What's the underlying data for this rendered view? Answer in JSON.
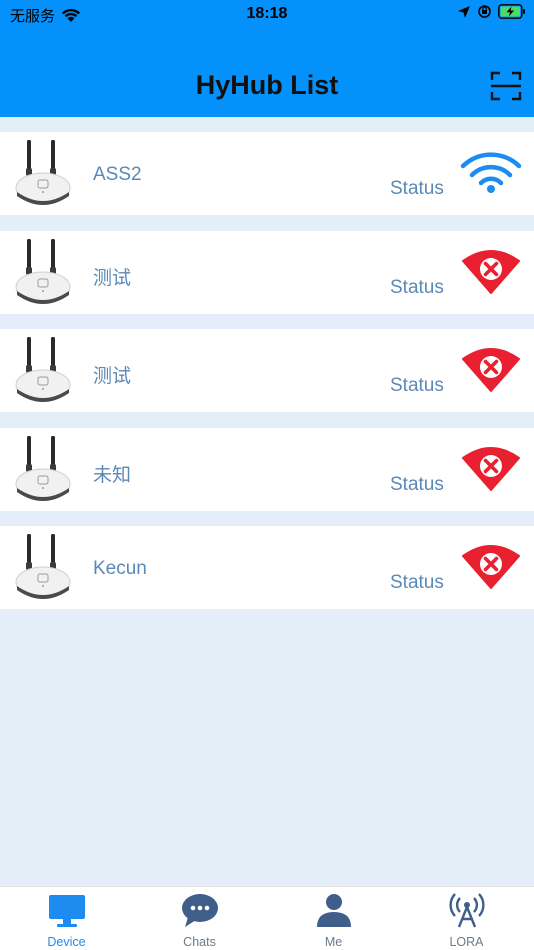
{
  "status_bar": {
    "carrier": "无服务",
    "time": "18:18"
  },
  "header": {
    "title": "HyHub List"
  },
  "devices": [
    {
      "name": "ASS2",
      "status_label": "Status",
      "status": "connected"
    },
    {
      "name": "测试",
      "status_label": "Status",
      "status": "disconnected"
    },
    {
      "name": "测试",
      "status_label": "Status",
      "status": "disconnected"
    },
    {
      "name": "未知",
      "status_label": "Status",
      "status": "disconnected"
    },
    {
      "name": "Kecun",
      "status_label": "Status",
      "status": "disconnected"
    }
  ],
  "tabbar": {
    "items": [
      {
        "label": "Device",
        "icon": "monitor-icon",
        "active": true
      },
      {
        "label": "Chats",
        "icon": "chat-bubble-icon",
        "active": false
      },
      {
        "label": "Me",
        "icon": "person-icon",
        "active": false
      },
      {
        "label": "LORA",
        "icon": "antenna-icon",
        "active": false
      }
    ]
  },
  "colors": {
    "header_bg": "#0591fb",
    "page_bg": "#e3eef8",
    "wifi_ok": "#1d8cf0",
    "wifi_error": "#e8202f",
    "tab_active": "#1d8cf0",
    "tab_inactive": "#3f5f8a"
  }
}
